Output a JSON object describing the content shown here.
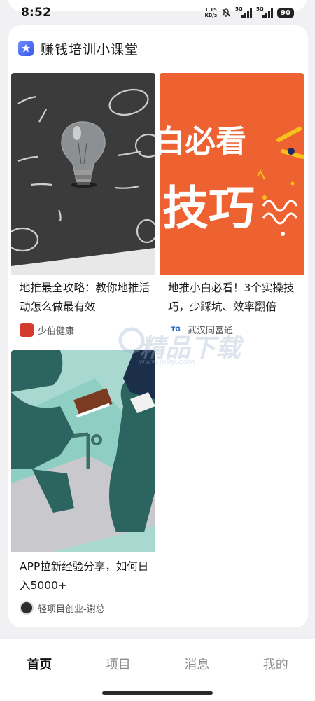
{
  "status_bar": {
    "time": "8:52",
    "net_speed_value": "1.15",
    "net_speed_unit": "KB/s",
    "signal1_label": "5G",
    "signal2_label": "5G",
    "battery": "90"
  },
  "header": {
    "title": "赚钱培训小课堂"
  },
  "feed": [
    {
      "title": "地推最全攻略：教你地推活动怎么做最有效",
      "source": "少伯健康"
    },
    {
      "title": "地推小白必看！3个实操技巧，少踩坑、效率翻倍",
      "source": "武汉同富通",
      "image_text_line1": "白必看",
      "image_text_line2": "技巧"
    },
    {
      "title": "APP拉新经验分享，如何日入5000+",
      "source": "轻项目创业-谢总"
    }
  ],
  "watermark": {
    "text": "精品下载",
    "url": "www.jb9p.com"
  },
  "bottom_nav": {
    "tabs": [
      {
        "label": "首页",
        "active": true
      },
      {
        "label": "项目",
        "active": false
      },
      {
        "label": "消息",
        "active": false
      },
      {
        "label": "我的",
        "active": false
      }
    ]
  },
  "colors": {
    "accent_orange": "#ee6232",
    "chalkboard": "#3a3a3a",
    "teal": "#8fcfc3"
  }
}
